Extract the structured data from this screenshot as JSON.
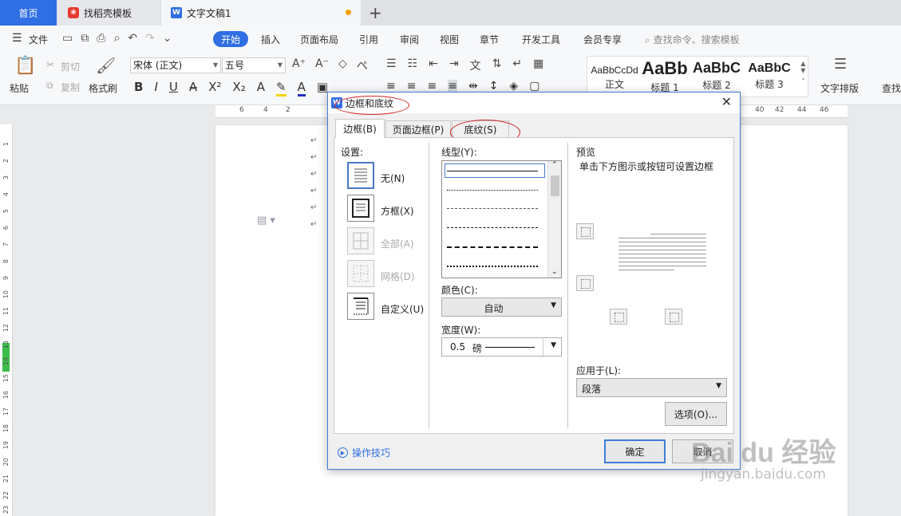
{
  "tabs": {
    "home": "首页",
    "template": "找稻壳模板",
    "doc": "文字文稿1",
    "add": "+"
  },
  "menu": {
    "file": "文件",
    "items": [
      "开始",
      "插入",
      "页面布局",
      "引用",
      "审阅",
      "视图",
      "章节",
      "开发工具",
      "会员专享"
    ],
    "search": "查找命令、搜索模板"
  },
  "ribbon": {
    "paste": "粘贴",
    "cut": "剪切",
    "copy": "复制",
    "format_painter": "格式刷",
    "font_name": "宋体 (正文)",
    "font_size": "五号",
    "styles": [
      {
        "preview": "AaBbCcDd",
        "label": "正文"
      },
      {
        "preview": "AaBb",
        "label": "标题 1"
      },
      {
        "preview": "AaBbC",
        "label": "标题 2"
      },
      {
        "preview": "AaBbC",
        "label": "标题 3"
      }
    ],
    "text_layout": "文字排版",
    "find": "查找"
  },
  "ruler_top": [
    "6",
    "4",
    "2",
    "40",
    "42",
    "44",
    "46"
  ],
  "ruler_left": [
    "1",
    "2",
    "3",
    "4",
    "5",
    "6",
    "7",
    "8",
    "9",
    "10",
    "11",
    "12",
    "13",
    "14",
    "15",
    "16",
    "17",
    "18",
    "19",
    "20",
    "21",
    "22",
    "23"
  ],
  "dialog": {
    "title": "边框和底纹",
    "tabs": [
      "边框(B)",
      "页面边框(P)",
      "底纹(S)"
    ],
    "settings_label": "设置:",
    "settings": [
      {
        "label": "无(N)",
        "enabled": true
      },
      {
        "label": "方框(X)",
        "enabled": true
      },
      {
        "label": "全部(A)",
        "enabled": false
      },
      {
        "label": "网格(D)",
        "enabled": false
      },
      {
        "label": "自定义(U)",
        "enabled": true
      }
    ],
    "line_style_label": "线型(Y):",
    "color_label": "颜色(C):",
    "color_value": "自动",
    "width_label": "宽度(W):",
    "width_value": "0.5",
    "width_unit": "磅",
    "preview_label": "预览",
    "preview_hint": "单击下方图示或按钮可设置边框",
    "apply_label": "应用于(L):",
    "apply_value": "段落",
    "options_button": "选项(O)...",
    "ok_button": "确定",
    "cancel_button": "取消",
    "tips_link": "操作技巧"
  },
  "watermark": {
    "line1": "Bai du 经验",
    "line2": "jingyan.baidu.com"
  },
  "colors": {
    "accent": "#2f6ee3",
    "annotation": "#d02020",
    "highlight_green": "#3cbf4a"
  }
}
